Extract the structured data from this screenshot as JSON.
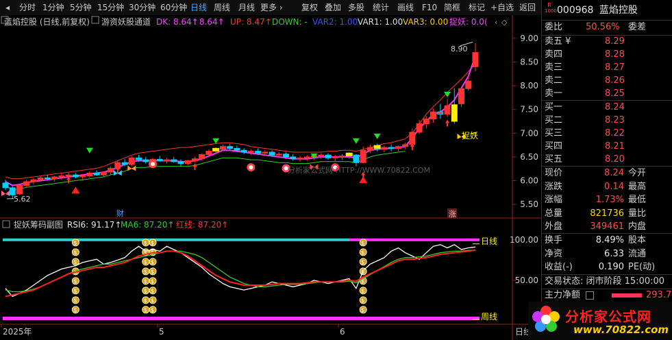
{
  "toolbar": {
    "items": [
      "分时",
      "1分钟",
      "5分钟",
      "15分钟",
      "30分钟",
      "60分钟",
      "日线",
      "周线",
      "月线",
      "更多 ›",
      "复权",
      "叠加",
      "多股",
      "统计",
      "画线",
      "F10",
      "简框",
      "标记",
      "+自选",
      "返回"
    ],
    "active": "日线"
  },
  "main_header": {
    "stock_title": "蓝焰控股 (日线,前复权)",
    "indicator_name": "游资妖股通道",
    "dk": "DK: 8.64↑",
    "val2": ": 8.64↑",
    "up": "UP: 8.47↑",
    "down": "DOWN: -",
    "var2": "VAR2: 1.00",
    "var1": "VAR1: 1.00",
    "var3": "VAR3: 0.00",
    "zhuoyao": "捉妖: 0.0("
  },
  "sub_header": {
    "name": "捉妖筹码副图",
    "rsi6": "RSI6: 91.17↑",
    "ma6": "MA6: 87.20↑",
    "hongxian": "红线: 87.20↑"
  },
  "annotations": {
    "high_label": "8.90",
    "low_label": "5.62",
    "zhuoyao_label": "捉妖",
    "cai_label": "财",
    "zhang_label": "涨",
    "rixian_label": "日线",
    "zhouxian_label": "周线"
  },
  "x_axis_labels": [
    "2025年",
    "5",
    "6"
  ],
  "x_axis_right": "日线",
  "watermark": "分析家公式网 HTTP://WWW.70822.COM",
  "logo": {
    "text": "分析家公式网",
    "url": "www.70822.com"
  },
  "colors": {
    "up": "#ff3333",
    "down": "#00d0ff",
    "dk": "#ff33ff",
    "upline": "#ff3333",
    "downline": "#33cc33",
    "yellow": "#ffee00",
    "rsi": "#ffffff",
    "ma6": "#33cc33",
    "hong": "#ff2222",
    "cyan": "#33cccc",
    "magenta": "#ff33ff"
  },
  "chart_data": [
    {
      "type": "candlestick",
      "title": "蓝焰控股 (日线,前复权)",
      "ylim": [
        5.3,
        9.2
      ],
      "y_ticks": [
        5.5,
        6.0,
        6.5,
        7.0,
        7.5,
        8.0,
        8.5,
        9.0
      ],
      "x_labels": [
        "2025年",
        "5",
        "6"
      ],
      "ohlc": [
        [
          5.95,
          6.02,
          5.8,
          5.85
        ],
        [
          5.85,
          5.88,
          5.62,
          5.7
        ],
        [
          5.72,
          5.92,
          5.7,
          5.9
        ],
        [
          5.9,
          6.02,
          5.86,
          5.98
        ],
        [
          5.98,
          6.05,
          5.92,
          6.02
        ],
        [
          6.02,
          6.1,
          5.98,
          6.06
        ],
        [
          6.06,
          6.12,
          6.0,
          6.04
        ],
        [
          6.04,
          6.1,
          5.98,
          6.08
        ],
        [
          6.08,
          6.15,
          6.02,
          6.1
        ],
        [
          6.1,
          6.18,
          6.05,
          6.12
        ],
        [
          6.12,
          6.16,
          6.05,
          6.08
        ],
        [
          6.08,
          6.14,
          6.0,
          6.1
        ],
        [
          6.1,
          6.2,
          6.06,
          6.16
        ],
        [
          6.16,
          6.22,
          6.1,
          6.12
        ],
        [
          6.12,
          6.2,
          6.08,
          6.18
        ],
        [
          6.18,
          6.3,
          6.12,
          6.26
        ],
        [
          6.26,
          6.42,
          6.2,
          6.38
        ],
        [
          6.38,
          6.46,
          6.3,
          6.34
        ],
        [
          6.34,
          6.52,
          6.3,
          6.48
        ],
        [
          6.48,
          6.55,
          6.4,
          6.44
        ],
        [
          6.44,
          6.5,
          6.36,
          6.4
        ],
        [
          6.4,
          6.48,
          6.34,
          6.45
        ],
        [
          6.45,
          6.52,
          6.4,
          6.42
        ],
        [
          6.42,
          6.48,
          6.36,
          6.44
        ],
        [
          6.44,
          6.5,
          6.38,
          6.4
        ],
        [
          6.4,
          6.45,
          6.3,
          6.36
        ],
        [
          6.36,
          6.44,
          6.32,
          6.42
        ],
        [
          6.42,
          6.5,
          6.38,
          6.46
        ],
        [
          6.46,
          6.58,
          6.42,
          6.55
        ],
        [
          6.55,
          6.66,
          6.5,
          6.62
        ],
        [
          6.62,
          6.7,
          6.56,
          6.66
        ],
        [
          6.66,
          6.76,
          6.62,
          6.72
        ],
        [
          6.72,
          6.78,
          6.64,
          6.68
        ],
        [
          6.68,
          6.74,
          6.6,
          6.64
        ],
        [
          6.64,
          6.68,
          6.56,
          6.6
        ],
        [
          6.6,
          6.66,
          6.54,
          6.62
        ],
        [
          6.62,
          6.68,
          6.55,
          6.58
        ],
        [
          6.58,
          6.64,
          6.52,
          6.6
        ],
        [
          6.6,
          6.64,
          6.5,
          6.54
        ],
        [
          6.54,
          6.6,
          6.48,
          6.56
        ],
        [
          6.56,
          6.6,
          6.46,
          6.5
        ],
        [
          6.5,
          6.56,
          6.42,
          6.46
        ],
        [
          6.46,
          6.52,
          6.4,
          6.48
        ],
        [
          6.48,
          6.54,
          6.42,
          6.5
        ],
        [
          6.5,
          6.56,
          6.44,
          6.52
        ],
        [
          6.52,
          6.58,
          6.46,
          6.54
        ],
        [
          6.54,
          6.58,
          6.44,
          6.48
        ],
        [
          6.48,
          6.54,
          6.4,
          6.5
        ],
        [
          6.5,
          6.56,
          6.44,
          6.52
        ],
        [
          6.52,
          6.6,
          6.46,
          6.54
        ],
        [
          6.54,
          6.56,
          6.3,
          6.38
        ],
        [
          6.38,
          6.72,
          6.36,
          6.64
        ],
        [
          6.64,
          6.76,
          6.58,
          6.7
        ],
        [
          6.7,
          6.78,
          6.62,
          6.66
        ],
        [
          6.66,
          6.74,
          6.6,
          6.7
        ],
        [
          6.7,
          6.76,
          6.62,
          6.68
        ],
        [
          6.68,
          6.74,
          6.62,
          6.72
        ],
        [
          6.72,
          6.8,
          6.66,
          6.76
        ],
        [
          6.76,
          7.1,
          6.74,
          7.02
        ],
        [
          7.02,
          7.28,
          6.98,
          7.2
        ],
        [
          7.2,
          7.36,
          7.1,
          7.3
        ],
        [
          7.3,
          7.52,
          7.22,
          7.45
        ],
        [
          7.45,
          7.62,
          7.3,
          7.4
        ],
        [
          7.4,
          7.72,
          7.34,
          7.58
        ],
        [
          7.6,
          7.95,
          7.2,
          7.25
        ],
        [
          7.62,
          7.98,
          7.55,
          7.94
        ],
        [
          7.94,
          8.25,
          7.9,
          8.1
        ],
        [
          8.4,
          8.9,
          8.3,
          8.7
        ]
      ],
      "dk_line": [
        5.98,
        5.9,
        5.92,
        5.96,
        5.98,
        6.0,
        6.02,
        6.04,
        6.06,
        6.08,
        6.1,
        6.12,
        6.14,
        6.16,
        6.18,
        6.22,
        6.28,
        6.34,
        6.4,
        6.42,
        6.42,
        6.42,
        6.42,
        6.42,
        6.42,
        6.4,
        6.4,
        6.42,
        6.46,
        6.52,
        6.58,
        6.64,
        6.64,
        6.62,
        6.6,
        6.58,
        6.56,
        6.54,
        6.52,
        6.5,
        6.48,
        6.46,
        6.46,
        6.46,
        6.48,
        6.5,
        6.5,
        6.5,
        6.5,
        6.5,
        6.48,
        6.56,
        6.64,
        6.66,
        6.68,
        6.68,
        6.7,
        6.72,
        6.9,
        7.1,
        7.25,
        7.4,
        7.45,
        7.55,
        7.7,
        7.95,
        8.2,
        8.64
      ],
      "up_line": [
        6.08,
        6.04,
        6.04,
        6.06,
        6.08,
        6.1,
        6.12,
        6.14,
        6.16,
        6.18,
        6.2,
        6.22,
        6.24,
        6.26,
        6.3,
        6.36,
        6.42,
        6.48,
        6.54,
        6.58,
        6.6,
        6.62,
        6.64,
        6.66,
        6.68,
        6.7,
        6.7,
        6.72,
        6.74,
        6.76,
        6.78,
        6.8,
        6.8,
        6.78,
        6.76,
        6.72,
        6.7,
        6.68,
        6.66,
        6.64,
        6.62,
        6.6,
        6.6,
        6.6,
        6.6,
        6.6,
        6.62,
        6.62,
        6.64,
        6.64,
        6.62,
        6.66,
        6.7,
        6.74,
        6.78,
        6.8,
        6.84,
        6.88,
        7.0,
        7.2,
        7.4,
        7.56,
        7.7,
        7.86,
        8.0,
        8.14,
        8.3,
        8.47
      ],
      "down_line": [
        5.9,
        5.8,
        5.82,
        5.86,
        5.88,
        5.9,
        5.92,
        5.94,
        5.96,
        5.98,
        6.0,
        6.02,
        6.04,
        6.06,
        6.08,
        6.12,
        6.16,
        6.2,
        6.26,
        6.28,
        6.28,
        6.3,
        6.3,
        6.3,
        6.3,
        6.3,
        6.3,
        6.32,
        6.36,
        6.4,
        6.44,
        6.48,
        6.48,
        6.48,
        6.46,
        6.44,
        6.44,
        6.42,
        6.4,
        6.38,
        6.38,
        6.36,
        6.36,
        6.36,
        6.38,
        6.4,
        6.4,
        6.4,
        6.4,
        6.4,
        6.38,
        6.44,
        6.5,
        6.54,
        6.56,
        6.58,
        6.6,
        6.62
      ]
    },
    {
      "type": "line",
      "title": "捉妖筹码副图",
      "ylim": [
        0,
        110
      ],
      "y_ticks": [
        50.0,
        100.0
      ],
      "series": [
        {
          "name": "RSI6",
          "values": [
            40,
            30,
            34,
            38,
            44,
            50,
            56,
            60,
            64,
            66,
            68,
            72,
            74,
            76,
            70,
            72,
            75,
            78,
            86,
            92,
            86,
            88,
            86,
            92,
            88,
            84,
            78,
            72,
            66,
            58,
            52,
            46,
            42,
            40,
            38,
            40,
            42,
            44,
            48,
            46,
            44,
            42,
            44,
            46,
            50,
            48,
            46,
            48,
            50,
            52,
            40,
            62,
            70,
            74,
            78,
            86,
            90,
            84,
            80,
            76,
            84,
            92,
            94,
            90,
            94,
            88,
            90,
            91.17
          ]
        },
        {
          "name": "MA6",
          "values": [
            38,
            36,
            36,
            37,
            39,
            42,
            46,
            50,
            54,
            58,
            62,
            64,
            66,
            68,
            70,
            70,
            72,
            74,
            76,
            78,
            80,
            82,
            84,
            86,
            86,
            86,
            84,
            82,
            78,
            72,
            66,
            60,
            54,
            50,
            46,
            44,
            42,
            42,
            43,
            44,
            45,
            45,
            45,
            46,
            47,
            48,
            48,
            48,
            48,
            49,
            47,
            52,
            57,
            62,
            67,
            72,
            76,
            78,
            78,
            79,
            80,
            82,
            84,
            85,
            86,
            86,
            87,
            87.2
          ]
        },
        {
          "name": "红线",
          "values": [
            30,
            32,
            34,
            36,
            38,
            42,
            46,
            50,
            54,
            58,
            60,
            62,
            64,
            66,
            66,
            68,
            70,
            72,
            76,
            80,
            82,
            84,
            84,
            86,
            86,
            84,
            80,
            74,
            68,
            62,
            56,
            52,
            48,
            46,
            44,
            44,
            44,
            44,
            45,
            46,
            46,
            46,
            46,
            47,
            48,
            48,
            48,
            48,
            49,
            50,
            49,
            54,
            58,
            62,
            66,
            70,
            74,
            76,
            76,
            77,
            78,
            80,
            82,
            83,
            84,
            85,
            86,
            87.2
          ]
        }
      ]
    }
  ],
  "quote_panel": {
    "code_logo": "R 1000",
    "code": "000968",
    "name": "蓝焰控股",
    "weibi_label": "委比",
    "weibi_value": "50.56%",
    "weicha_label": "委差",
    "sell": [
      {
        "label": "卖五 ¥",
        "price": "8.29"
      },
      {
        "label": "卖四",
        "price": "8.28"
      },
      {
        "label": "卖三",
        "price": "8.27"
      },
      {
        "label": "卖二",
        "price": "8.26"
      },
      {
        "label": "卖一",
        "price": "8.25"
      }
    ],
    "buy": [
      {
        "label": "买一",
        "price": "8.24"
      },
      {
        "label": "买二",
        "price": "8.23"
      },
      {
        "label": "买三",
        "price": "8.22"
      },
      {
        "label": "买四",
        "price": "8.21"
      },
      {
        "label": "买五",
        "price": "8.20"
      }
    ],
    "stats": [
      {
        "l1": "现价",
        "v1": "8.24",
        "l2": "今开"
      },
      {
        "l1": "涨跌",
        "v1": "0.14",
        "l2": "最高"
      },
      {
        "l1": "涨幅",
        "v1": "1.73%",
        "l2": "最低"
      },
      {
        "l1": "总量",
        "v1": "821736",
        "l2": "量比"
      },
      {
        "l1": "外盘",
        "v1": "349461",
        "l2": "内盘"
      }
    ],
    "stats2": [
      {
        "l1": "换手",
        "v1": "8.49%",
        "l2": "股本"
      },
      {
        "l1": "净资",
        "v1": "6.33",
        "l2": "流通"
      },
      {
        "l1": "收益(-)",
        "v1": "0.190",
        "l2": "PE(动)"
      }
    ],
    "trade_status": "交易状态: 闭市阶段 15:00:00",
    "main_net_label": "主力净额",
    "main_net_value": "293.7"
  }
}
